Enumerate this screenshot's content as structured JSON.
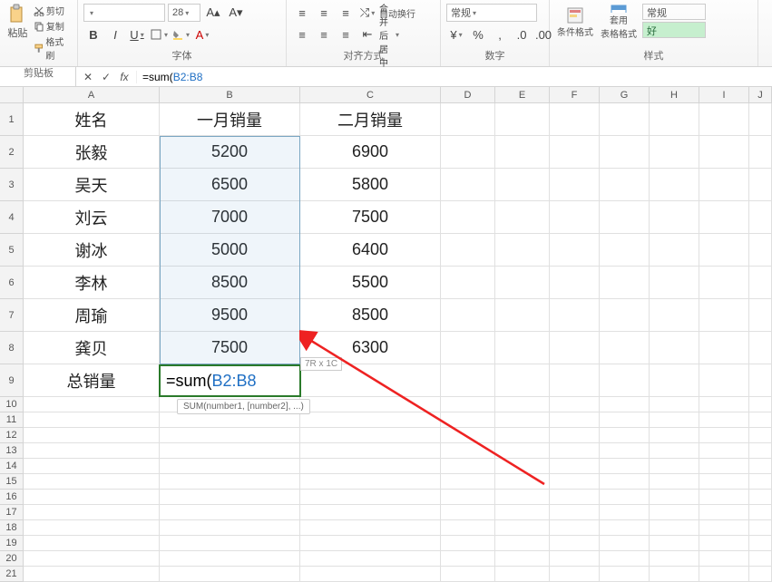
{
  "ribbon": {
    "clipboard": {
      "label": "剪贴板",
      "paste": "粘贴",
      "cut": "剪切",
      "copy": "复制",
      "format_painter": "格式刷"
    },
    "font": {
      "label": "字体",
      "family": "",
      "size": "28",
      "bold": "B",
      "italic": "I",
      "underline": "U"
    },
    "alignment": {
      "label": "对齐方式",
      "wrap": "自动换行",
      "merge": "合并后居中"
    },
    "number": {
      "label": "数字",
      "format": "常规"
    },
    "styles": {
      "label": "样式",
      "cond_fmt": "条件格式",
      "table": "套用\n表格格式",
      "normal": "常规",
      "good": "好"
    }
  },
  "formula_bar": {
    "name_box": "",
    "formula_black1": "=sum(",
    "formula_blue": "B2:B8"
  },
  "columns": [
    "A",
    "B",
    "C",
    "D",
    "E",
    "F",
    "G",
    "H",
    "I",
    "J"
  ],
  "selection_dim": "7R x 1C",
  "tooltip": "SUM(number1, [number2], ...)",
  "active_formula_black": "=sum(",
  "active_formula_blue": "B2:B8",
  "chart_data": {
    "type": "table",
    "headers": [
      "姓名",
      "一月销量",
      "二月销量"
    ],
    "rows": [
      [
        "张毅",
        5200,
        6900
      ],
      [
        "吴天",
        6500,
        5800
      ],
      [
        "刘云",
        7000,
        7500
      ],
      [
        "谢冰",
        5000,
        6400
      ],
      [
        "李林",
        8500,
        5500
      ],
      [
        "周瑜",
        9500,
        8500
      ],
      [
        "龚贝",
        7500,
        6300
      ]
    ],
    "footer_label": "总销量"
  }
}
